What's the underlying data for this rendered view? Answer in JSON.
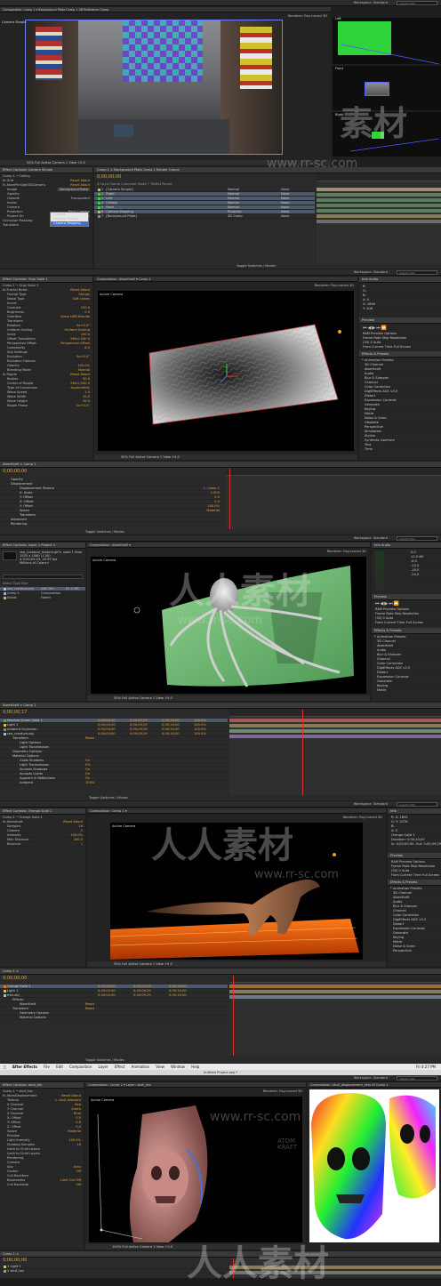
{
  "s1": {
    "workspace": "Workspace:  Standard",
    "search": "Search Help",
    "tabs": "Composition: Comp 1 ▾   Background Plate   Comp 1   3D Reference Comp",
    "view_label": "Camera Simple",
    "quad_labels": [
      "Left",
      "Front",
      "Right"
    ],
    "renderer": "Renderer:   Ray-traced 3D",
    "footer": "50%   Full   Active Camera   1 View   +0.0",
    "effect_header": "Effect Controls: Camera Simple",
    "effect_rows": [
      "Comp 1 • Ceiling",
      "fx  Grid",
      "fx  AtomPinSight3DCamera",
      "Image",
      "Opacity",
      "Outside",
      "Inside",
      "Camera",
      "Projection",
      "Project On",
      "Occlusion Masking",
      "Transform"
    ],
    "effect_vals": [
      "Reset  About",
      "Reset  About",
      "Background Plate",
      "",
      "",
      "Transparent",
      "",
      "Point Camera",
      "Both Sides",
      "",
      "",
      ""
    ],
    "dropdown_opts": [
      "Current",
      "Camera Simple",
      "Camera Mapping"
    ],
    "tl_tabs": "Comp 1 ×   Background Plate   Comp 1   Render Queue",
    "tl_time": "0;00;00;00",
    "layers": [
      {
        "n": "1",
        "name": "[Camera Simple]",
        "mode": "Normal",
        "parent": "None"
      },
      {
        "n": "2",
        "name": "Right",
        "mode": "Normal",
        "parent": "None"
      },
      {
        "n": "3",
        "name": "Left",
        "mode": "Normal",
        "parent": "None"
      },
      {
        "n": "4",
        "name": "Ceiling",
        "mode": "Normal",
        "parent": "None"
      },
      {
        "n": "5",
        "name": "Back",
        "mode": "Normal",
        "parent": "None"
      },
      {
        "n": "6",
        "name": "Camera Mapping",
        "mode": "Projector",
        "parent": "None"
      },
      {
        "n": "7",
        "name": "[Background Plate]",
        "mode": "3D Comp",
        "parent": "None"
      }
    ],
    "tl_cols": "#   Layer Name   Comment   Mode   T   TrkMat   Parent",
    "tl_footer": "Toggle Switches / Modes"
  },
  "s2": {
    "workspace": "Workspace:  Standard",
    "search": "Search Help",
    "effect_header": "Effect Controls: Gray Solid 1",
    "effect_rows": [
      "Comp 1 • Gray Solid 1",
      "fx  Fractal Noise",
      "Fractal Type",
      "Noise Type",
      "Invert",
      "Contrast",
      "Brightness",
      "Overflow",
      "Transform",
      "Rotation",
      "Uniform Scaling",
      "Scale",
      "Offset Turbulence",
      "Perspective Offset",
      "Complexity",
      "Sub Settings",
      "Evolution",
      "Evolution Options",
      "Opacity",
      "Blending Mode",
      "fx  Ripple",
      "Radius",
      "Center of Ripple",
      "Type of Conversion",
      "Wave Speed",
      "Wave Width",
      "Wave Height",
      "Ripple Phase"
    ],
    "effect_vals": [
      "",
      "Reset  About",
      "Strings",
      "Soft Linear",
      "",
      "100.0",
      "0.0",
      "Allow HDR Results",
      "",
      "0x+0.0°",
      "Uniform Scaling",
      "100.0",
      "960.0,540.0",
      "Perspective Offset",
      "6.0",
      "",
      "0x+0.0°",
      "",
      "100.0%",
      "Normal",
      "Reset  About",
      "50.0",
      "960.0,540.0",
      "Asymmetric",
      "1.0",
      "20.0",
      "20.0",
      "0x+0.0°"
    ],
    "comp_tabs": "Composition: AtomKraft ▾   Comp 1",
    "view_label": "Active Camera",
    "renderer": "Renderer:   Ray-traced 3D",
    "footer": "50%   Full   Active Camera   1 View   +0.0",
    "info": [
      "R:",
      "G:",
      "B:",
      "A: 0",
      "X: 1896",
      "Y: 308"
    ],
    "preview_header": "Preview",
    "preview_rows": [
      "RAM Preview Options",
      "Frame Rate  Skip  Resolution",
      "(30)  0  Auto",
      "From Current Time   Full Screen"
    ],
    "fx_header": "Effects & Presets",
    "fx_list": [
      "* Animation Presets",
      "3D Channel",
      "AtomKraft",
      "Audio",
      "Blur & Sharpen",
      "Channel",
      "Color Correction",
      "DigiEffects ADC v3.5",
      "Distort",
      "Expression Controls",
      "Generate",
      "Keying",
      "Matte",
      "Noise & Grain",
      "Obsolete",
      "Perspective",
      "Simulation",
      "Stylize",
      "Synthetic Aperture",
      "Text",
      "Time"
    ],
    "tl_tabs": "AtomKraft ×   Comp 1",
    "tl_time": "0;00;00;00",
    "tl_rows": [
      "Opacity",
      "Displacement",
      "Displacement Texture",
      "X: Scale",
      "Y: Offset",
      "Z: Offset",
      "Y: Offset",
      "Space",
      "Transform",
      "Advanced",
      "Rendering"
    ],
    "tl_vals": [
      "",
      "",
      "1. Comp 1",
      "1.000",
      "0.0",
      "0.0",
      "100.0%",
      "Material",
      "",
      "",
      ""
    ],
    "tl_footer": "Toggle Switches / Modes"
  },
  "s3": {
    "workspace": "Workspace:  Standard",
    "search": "Search Help",
    "project_header": "Effect Controls: Layer 1   Project ×",
    "project_info": [
      "sea_creature_texture.gif ▾, used 1 time",
      "1920 x 1080 (1.00)",
      "Δ 0;00;09;29, 29.97 fps",
      "Millions of Colors+"
    ],
    "project_cols": "Name   Type   Size",
    "project_items": [
      {
        "name": "sea_creature.obj",
        "type": "ABC File",
        "size": "61.2 MB"
      },
      {
        "name": "Comp 1",
        "type": "Composition",
        "size": ""
      },
      {
        "name": "Solids",
        "type": "Folder",
        "size": ""
      }
    ],
    "comp_tabs": "Composition: AtomKraft ▾",
    "view_label": "Active Camera",
    "renderer": "Renderer:   Ray-traced 3D",
    "footer": "50%   Full   Active Camera   1 View   +0.0",
    "audio_values": [
      "0.0",
      "12.0 dB",
      "-6.0",
      "-12.0",
      "-18.0",
      "-24.0"
    ],
    "preview_header": "Preview",
    "preview_rows": [
      "RAM Preview Options",
      "Frame Rate  Skip  Resolution",
      "(30)  0  Auto",
      "From Current Time   Full Screen"
    ],
    "fx_header": "Effects & Presets",
    "fx_list": [
      "* Animation Presets",
      "3D Channel",
      "AtomKraft",
      "Audio",
      "Blur & Sharpen",
      "Channel",
      "Color Correction",
      "DigiEffects ADC v3.5",
      "Distort",
      "Expression Controls",
      "Generate",
      "Keying",
      "Matte"
    ],
    "tl_tabs": "AtomKraft ×   Comp 1",
    "tl_time": "0;00;00;17",
    "tl_layers": [
      {
        "name": "Medium Green Solid 1",
        "in": "0;00;00;00",
        "out": "0;00;09;29",
        "dur": "0;00;10;00",
        "str": "100.0%"
      },
      {
        "name": "Light 1",
        "in": "0;00;00;00",
        "out": "0;00;09;29",
        "dur": "0;00;10;00",
        "str": "100.0%"
      },
      {
        "name": "Ambient Occlusion",
        "in": "0;00;00;00",
        "out": "0;00;09;29",
        "dur": "0;00;10;00",
        "str": "100.0%"
      },
      {
        "name": "sea_creature.obj",
        "in": "0;00;00;00",
        "out": "0;00;09;29",
        "dur": "0;00;10;00",
        "str": "100.0%"
      }
    ],
    "tl_props": [
      "Transform",
      "Light Options",
      "Light Transmission",
      "Geometry Options",
      "Material Options",
      "Casts Shadows",
      "Light Transmission",
      "Accepts Shadows",
      "Accepts Lights",
      "Appears in Reflections",
      "Ambient"
    ],
    "tl_prop_vals": [
      "Reset",
      "",
      "",
      "",
      "",
      "On",
      "0%",
      "On",
      "On",
      "On",
      "100%"
    ],
    "tl_footer": "Toggle Switches / Modes"
  },
  "s4": {
    "workspace": "Workspace:  Standard",
    "search": "Search Help",
    "effect_header": "Effect Controls: Orange Solid 1",
    "effect_rows": [
      "Comp 1 • Orange Solid 1",
      "fx  AtomKraft",
      "Samples",
      "Camera",
      "Intensity",
      "Max Distance",
      "Bounces"
    ],
    "effect_vals": [
      "",
      "Reset  About",
      "16",
      "1",
      "100.0%",
      "200.0",
      "1"
    ],
    "comp_tabs": "Composition: Comp 1 ▾",
    "view_label": "Active Camera",
    "renderer": "Renderer:   Ray-traced 3D",
    "footer": "50%   Full   Active Camera   1 View   +0.0",
    "info_rows": [
      "R:  X: 1892",
      "G:  Y: 1076",
      "B:",
      "A: 0"
    ],
    "info_text": [
      "Orange Solid 1",
      "Duration: 0;00;10;00",
      "In: 0;00;00;00, Out: 0;00;09;29"
    ],
    "preview_header": "Preview",
    "preview_rows": [
      "RAM Preview Options",
      "Frame Rate  Skip  Resolution",
      "(30)  0  Auto",
      "From Current Time   Full Screen"
    ],
    "fx_header": "Effects & Presets",
    "fx_list": [
      "* Animation Presets",
      "3D Channel",
      "AtomKraft",
      "Audio",
      "Blur & Sharpen",
      "Channel",
      "Color Correction",
      "DigiEffects ADC v3.5",
      "Distort",
      "Expression Controls",
      "Generate",
      "Keying",
      "Matte",
      "Noise & Grain",
      "Perspective"
    ],
    "tl_tabs": "Comp 1 ×",
    "tl_time": "0;00;00;00",
    "tl_layers": [
      {
        "name": "Orange Solid 1",
        "in": "0;00;00;00",
        "out": "0;00;09;29",
        "dur": "0;00;10;00"
      },
      {
        "name": "Light 1",
        "in": "0;00;00;00",
        "out": "0;00;09;29",
        "dur": "0;00;10;00"
      },
      {
        "name": "trex.obj",
        "in": "0;00;00;00",
        "out": "0;00;09;29",
        "dur": "0;00;10;00"
      }
    ],
    "tl_props": [
      "Effects",
      "AtomKraft",
      "Transform",
      "Geometry Options",
      "Material Options"
    ],
    "tl_prop_vals": [
      "",
      "Reset",
      "Reset",
      "",
      ""
    ],
    "tl_footer": "Toggle Switches / Modes"
  },
  "s5": {
    "apple": "",
    "menus": [
      "After Effects",
      "File",
      "Edit",
      "Composition",
      "Layer",
      "Effect",
      "Animation",
      "View",
      "Window",
      "Help"
    ],
    "clock": "Fri 4:27 PM",
    "window_title": "Untitled Project.aep *",
    "workspace": "Workspace:  Standard",
    "search": "Search Help",
    "effect_header": "Effect Controls: skull_tex",
    "effect_rows": [
      "Comp 1 • skull_tex",
      "fx  AtomDisplacement",
      "Texture",
      "X Channel",
      "Y Channel",
      "Z Channel",
      "X: Offset",
      "Y: Offset",
      "Z: Offset",
      "Space",
      "Preview",
      "Light Intensity",
      "Shading Samples",
      "Limit to Child Layers",
      "Limit to Child Layers",
      "Rendering",
      "Camera",
      "Adv",
      "Center",
      "Cull Backface",
      "Boundaries",
      "Cull Backside"
    ],
    "effect_vals": [
      "",
      "Reset  About",
      "1. skull_displace",
      "Red",
      "Green",
      "Blue",
      "0.0",
      "0.0",
      "0.0",
      "Material",
      "",
      "100.0%",
      "16",
      "",
      "",
      "",
      "",
      "Auto",
      "Off",
      "",
      "Limit Cull Off",
      "Off"
    ],
    "comp_tabs": "Composition: Comp 1 ▾   Layer: skull_tex",
    "view_label": "Active Camera",
    "renderer": "Renderer:   Ray-traced 3D",
    "footer": "100%   Full   Active Camera   1 View   +0.0",
    "comp2_tabs": "Composition: skull_displacement_skin.tif Comp 1",
    "tl_tabs": "Comp 1 ×",
    "tl_time": "0;00;00;00",
    "tl_layers": [
      "Light 1",
      "skull_tex"
    ]
  },
  "watermark": {
    "brand": "人人素材",
    "brand_short": "素材",
    "url": "www.rr-sc.com",
    "seal": "ATOM KRAFT"
  }
}
